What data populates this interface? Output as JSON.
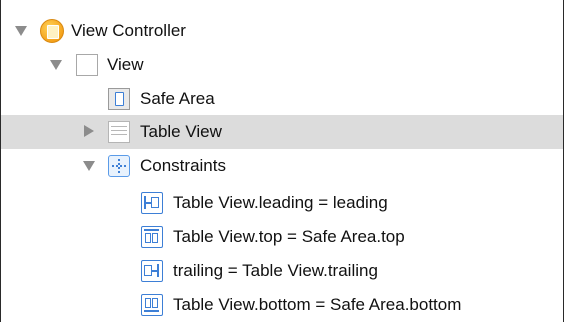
{
  "tree": {
    "view_controller": {
      "label": "View Controller",
      "icon": "view-controller-icon",
      "expanded": true
    },
    "view": {
      "label": "View",
      "icon": "view-icon",
      "expanded": true
    },
    "safe_area": {
      "label": "Safe Area",
      "icon": "safe-area-icon"
    },
    "table_view": {
      "label": "Table View",
      "icon": "table-view-icon",
      "expanded": false,
      "selected": true
    },
    "constraints": {
      "label": "Constraints",
      "icon": "constraints-icon",
      "expanded": true
    },
    "constraint_items": [
      {
        "label": "Table View.leading = leading",
        "icon": "leading-constraint-icon"
      },
      {
        "label": "Table View.top = Safe Area.top",
        "icon": "top-constraint-icon"
      },
      {
        "label": "trailing = Table View.trailing",
        "icon": "trailing-constraint-icon"
      },
      {
        "label": "Table View.bottom = Safe Area.bottom",
        "icon": "bottom-constraint-icon"
      }
    ]
  },
  "colors": {
    "accent": "#3d7fd6",
    "selection": "#dcdcdc",
    "disclosure": "#8c8c8c",
    "view_controller": "#f5a21a"
  }
}
